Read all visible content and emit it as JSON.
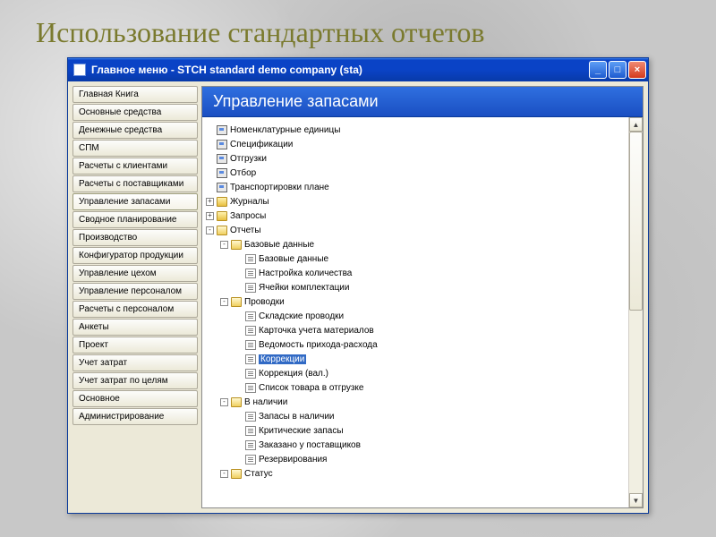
{
  "slide_title": "Использование стандартных отчетов",
  "window": {
    "title": "Главное меню  -  STCH standard demo company (sta)"
  },
  "sidebar": {
    "items": [
      "Главная Книга",
      "Основные средства",
      "Денежные средства",
      "СПМ",
      "Расчеты с клиентами",
      "Расчеты с поставщиками",
      "Управление запасами",
      "Сводное планирование",
      "Производство",
      "Конфигуратор продукции",
      "Управление цехом",
      "Управление персоналом",
      "Расчеты с персоналом",
      "Анкеты",
      "Проект",
      "Учет затрат",
      "Учет затрат по целям",
      "Основное",
      "Администрирование"
    ],
    "active_index": 6
  },
  "content": {
    "header": "Управление запасами",
    "tree": [
      {
        "indent": 0,
        "toggle": "",
        "icon": "form",
        "label": "Номенклатурные единицы"
      },
      {
        "indent": 0,
        "toggle": "",
        "icon": "form",
        "label": "Спецификации"
      },
      {
        "indent": 0,
        "toggle": "",
        "icon": "form",
        "label": "Отгрузки"
      },
      {
        "indent": 0,
        "toggle": "",
        "icon": "form",
        "label": "Отбор"
      },
      {
        "indent": 0,
        "toggle": "",
        "icon": "form",
        "label": "Транспортировки плане"
      },
      {
        "indent": 0,
        "toggle": "+",
        "icon": "folder",
        "label": "Журналы"
      },
      {
        "indent": 0,
        "toggle": "+",
        "icon": "folder",
        "label": "Запросы"
      },
      {
        "indent": 0,
        "toggle": "-",
        "icon": "folder-open",
        "label": "Отчеты"
      },
      {
        "indent": 1,
        "toggle": "-",
        "icon": "folder-open",
        "label": "Базовые данные"
      },
      {
        "indent": 2,
        "toggle": "",
        "icon": "doc",
        "label": "Базовые данные"
      },
      {
        "indent": 2,
        "toggle": "",
        "icon": "doc",
        "label": "Настройка количества"
      },
      {
        "indent": 2,
        "toggle": "",
        "icon": "doc",
        "label": "Ячейки комплектации"
      },
      {
        "indent": 1,
        "toggle": "-",
        "icon": "folder-open",
        "label": "Проводки"
      },
      {
        "indent": 2,
        "toggle": "",
        "icon": "doc",
        "label": "Складские проводки"
      },
      {
        "indent": 2,
        "toggle": "",
        "icon": "doc",
        "label": "Карточка учета материалов"
      },
      {
        "indent": 2,
        "toggle": "",
        "icon": "doc",
        "label": "Ведомость прихода-расхода"
      },
      {
        "indent": 2,
        "toggle": "",
        "icon": "doc",
        "label": "Коррекции",
        "selected": true
      },
      {
        "indent": 2,
        "toggle": "",
        "icon": "doc",
        "label": "Коррекция (вал.)"
      },
      {
        "indent": 2,
        "toggle": "",
        "icon": "doc",
        "label": "Список товара в отгрузке"
      },
      {
        "indent": 1,
        "toggle": "-",
        "icon": "folder-open",
        "label": "В наличии"
      },
      {
        "indent": 2,
        "toggle": "",
        "icon": "doc",
        "label": "Запасы в наличии"
      },
      {
        "indent": 2,
        "toggle": "",
        "icon": "doc",
        "label": "Критические запасы"
      },
      {
        "indent": 2,
        "toggle": "",
        "icon": "doc",
        "label": "Заказано у поставщиков"
      },
      {
        "indent": 2,
        "toggle": "",
        "icon": "doc",
        "label": "Резервирования"
      },
      {
        "indent": 1,
        "toggle": "-",
        "icon": "folder-open",
        "label": "Статус"
      }
    ]
  }
}
